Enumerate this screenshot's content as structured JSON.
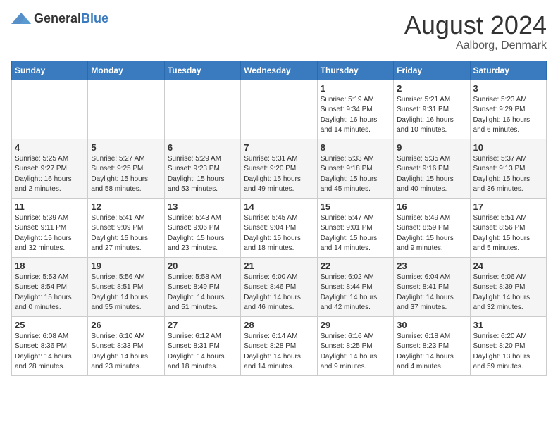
{
  "header": {
    "logo_general": "General",
    "logo_blue": "Blue",
    "main_title": "August 2024",
    "sub_title": "Aalborg, Denmark"
  },
  "calendar": {
    "days_of_week": [
      "Sunday",
      "Monday",
      "Tuesday",
      "Wednesday",
      "Thursday",
      "Friday",
      "Saturday"
    ],
    "weeks": [
      [
        {
          "day": "",
          "info": ""
        },
        {
          "day": "",
          "info": ""
        },
        {
          "day": "",
          "info": ""
        },
        {
          "day": "",
          "info": ""
        },
        {
          "day": "1",
          "info": "Sunrise: 5:19 AM\nSunset: 9:34 PM\nDaylight: 16 hours\nand 14 minutes."
        },
        {
          "day": "2",
          "info": "Sunrise: 5:21 AM\nSunset: 9:31 PM\nDaylight: 16 hours\nand 10 minutes."
        },
        {
          "day": "3",
          "info": "Sunrise: 5:23 AM\nSunset: 9:29 PM\nDaylight: 16 hours\nand 6 minutes."
        }
      ],
      [
        {
          "day": "4",
          "info": "Sunrise: 5:25 AM\nSunset: 9:27 PM\nDaylight: 16 hours\nand 2 minutes."
        },
        {
          "day": "5",
          "info": "Sunrise: 5:27 AM\nSunset: 9:25 PM\nDaylight: 15 hours\nand 58 minutes."
        },
        {
          "day": "6",
          "info": "Sunrise: 5:29 AM\nSunset: 9:23 PM\nDaylight: 15 hours\nand 53 minutes."
        },
        {
          "day": "7",
          "info": "Sunrise: 5:31 AM\nSunset: 9:20 PM\nDaylight: 15 hours\nand 49 minutes."
        },
        {
          "day": "8",
          "info": "Sunrise: 5:33 AM\nSunset: 9:18 PM\nDaylight: 15 hours\nand 45 minutes."
        },
        {
          "day": "9",
          "info": "Sunrise: 5:35 AM\nSunset: 9:16 PM\nDaylight: 15 hours\nand 40 minutes."
        },
        {
          "day": "10",
          "info": "Sunrise: 5:37 AM\nSunset: 9:13 PM\nDaylight: 15 hours\nand 36 minutes."
        }
      ],
      [
        {
          "day": "11",
          "info": "Sunrise: 5:39 AM\nSunset: 9:11 PM\nDaylight: 15 hours\nand 32 minutes."
        },
        {
          "day": "12",
          "info": "Sunrise: 5:41 AM\nSunset: 9:09 PM\nDaylight: 15 hours\nand 27 minutes."
        },
        {
          "day": "13",
          "info": "Sunrise: 5:43 AM\nSunset: 9:06 PM\nDaylight: 15 hours\nand 23 minutes."
        },
        {
          "day": "14",
          "info": "Sunrise: 5:45 AM\nSunset: 9:04 PM\nDaylight: 15 hours\nand 18 minutes."
        },
        {
          "day": "15",
          "info": "Sunrise: 5:47 AM\nSunset: 9:01 PM\nDaylight: 15 hours\nand 14 minutes."
        },
        {
          "day": "16",
          "info": "Sunrise: 5:49 AM\nSunset: 8:59 PM\nDaylight: 15 hours\nand 9 minutes."
        },
        {
          "day": "17",
          "info": "Sunrise: 5:51 AM\nSunset: 8:56 PM\nDaylight: 15 hours\nand 5 minutes."
        }
      ],
      [
        {
          "day": "18",
          "info": "Sunrise: 5:53 AM\nSunset: 8:54 PM\nDaylight: 15 hours\nand 0 minutes."
        },
        {
          "day": "19",
          "info": "Sunrise: 5:56 AM\nSunset: 8:51 PM\nDaylight: 14 hours\nand 55 minutes."
        },
        {
          "day": "20",
          "info": "Sunrise: 5:58 AM\nSunset: 8:49 PM\nDaylight: 14 hours\nand 51 minutes."
        },
        {
          "day": "21",
          "info": "Sunrise: 6:00 AM\nSunset: 8:46 PM\nDaylight: 14 hours\nand 46 minutes."
        },
        {
          "day": "22",
          "info": "Sunrise: 6:02 AM\nSunset: 8:44 PM\nDaylight: 14 hours\nand 42 minutes."
        },
        {
          "day": "23",
          "info": "Sunrise: 6:04 AM\nSunset: 8:41 PM\nDaylight: 14 hours\nand 37 minutes."
        },
        {
          "day": "24",
          "info": "Sunrise: 6:06 AM\nSunset: 8:39 PM\nDaylight: 14 hours\nand 32 minutes."
        }
      ],
      [
        {
          "day": "25",
          "info": "Sunrise: 6:08 AM\nSunset: 8:36 PM\nDaylight: 14 hours\nand 28 minutes."
        },
        {
          "day": "26",
          "info": "Sunrise: 6:10 AM\nSunset: 8:33 PM\nDaylight: 14 hours\nand 23 minutes."
        },
        {
          "day": "27",
          "info": "Sunrise: 6:12 AM\nSunset: 8:31 PM\nDaylight: 14 hours\nand 18 minutes."
        },
        {
          "day": "28",
          "info": "Sunrise: 6:14 AM\nSunset: 8:28 PM\nDaylight: 14 hours\nand 14 minutes."
        },
        {
          "day": "29",
          "info": "Sunrise: 6:16 AM\nSunset: 8:25 PM\nDaylight: 14 hours\nand 9 minutes."
        },
        {
          "day": "30",
          "info": "Sunrise: 6:18 AM\nSunset: 8:23 PM\nDaylight: 14 hours\nand 4 minutes."
        },
        {
          "day": "31",
          "info": "Sunrise: 6:20 AM\nSunset: 8:20 PM\nDaylight: 13 hours\nand 59 minutes."
        }
      ]
    ]
  }
}
